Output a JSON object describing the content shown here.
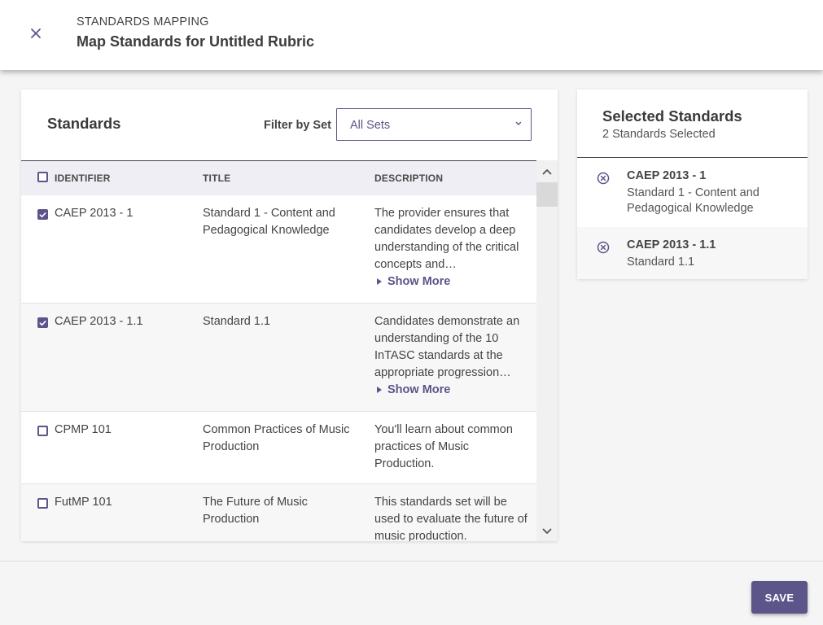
{
  "header": {
    "eyebrow": "STANDARDS MAPPING",
    "title": "Map Standards for Untitled Rubric",
    "close_icon": "close-icon"
  },
  "standards_panel": {
    "title": "Standards",
    "filter_label": "Filter by Set",
    "filter_value": "All Sets",
    "columns": [
      "IDENTIFIER",
      "TITLE",
      "DESCRIPTION"
    ],
    "show_more_label": "Show More",
    "rows": [
      {
        "checked": true,
        "identifier": "CAEP 2013 - 1",
        "title": "Standard 1 - Content and Pedagogical Knowledge",
        "description": "The provider ensures that candidates develop a deep understanding of the critical concepts and…"
      },
      {
        "checked": true,
        "identifier": "CAEP 2013 - 1.1",
        "title": "Standard 1.1",
        "description": "Candidates demonstrate an understanding of the 10 InTASC standards at the appropriate progression…"
      },
      {
        "checked": false,
        "identifier": "CPMP 101",
        "title": "Common Practices of Music Production",
        "description": "You'll learn about common practices of Music Production."
      },
      {
        "checked": false,
        "identifier": "FutMP 101",
        "title": "The Future of Music Production",
        "description": "This standards set will be used to evaluate the future of music production."
      }
    ]
  },
  "selected_panel": {
    "title": "Selected Standards",
    "subtitle": "2 Standards Selected",
    "items": [
      {
        "identifier": "CAEP 2013 - 1",
        "title": "Standard 1 - Content and Pedagogical Knowledge"
      },
      {
        "identifier": "CAEP 2013 - 1.1",
        "title": "Standard 1.1"
      }
    ]
  },
  "footer": {
    "save_label": "SAVE"
  },
  "colors": {
    "accent": "#5b5589",
    "header_row": "#eeeef4"
  }
}
